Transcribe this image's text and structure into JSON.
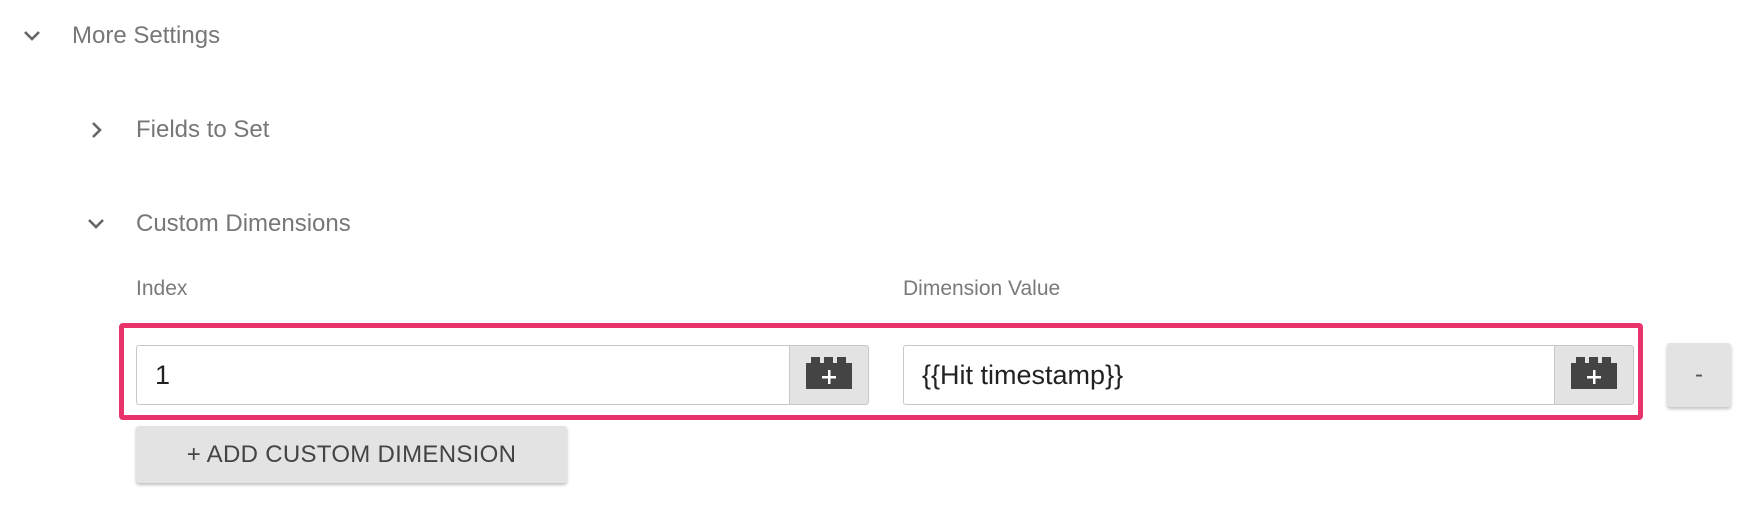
{
  "sections": {
    "more_settings": {
      "title": "More Settings",
      "expanded": true
    },
    "fields_to_set": {
      "title": "Fields to Set",
      "expanded": false
    },
    "custom_dimensions": {
      "title": "Custom Dimensions",
      "expanded": true
    }
  },
  "custom_dimensions": {
    "index_label": "Index",
    "value_label": "Dimension Value",
    "rows": [
      {
        "index": "1",
        "value": "{{Hit timestamp}}"
      }
    ],
    "remove_label": "-",
    "add_label": "+ ADD CUSTOM DIMENSION",
    "variable_icon": "add-variable-icon"
  },
  "colors": {
    "highlight": "#e8336d",
    "button_bg": "#e3e3e3",
    "label": "#777777"
  }
}
